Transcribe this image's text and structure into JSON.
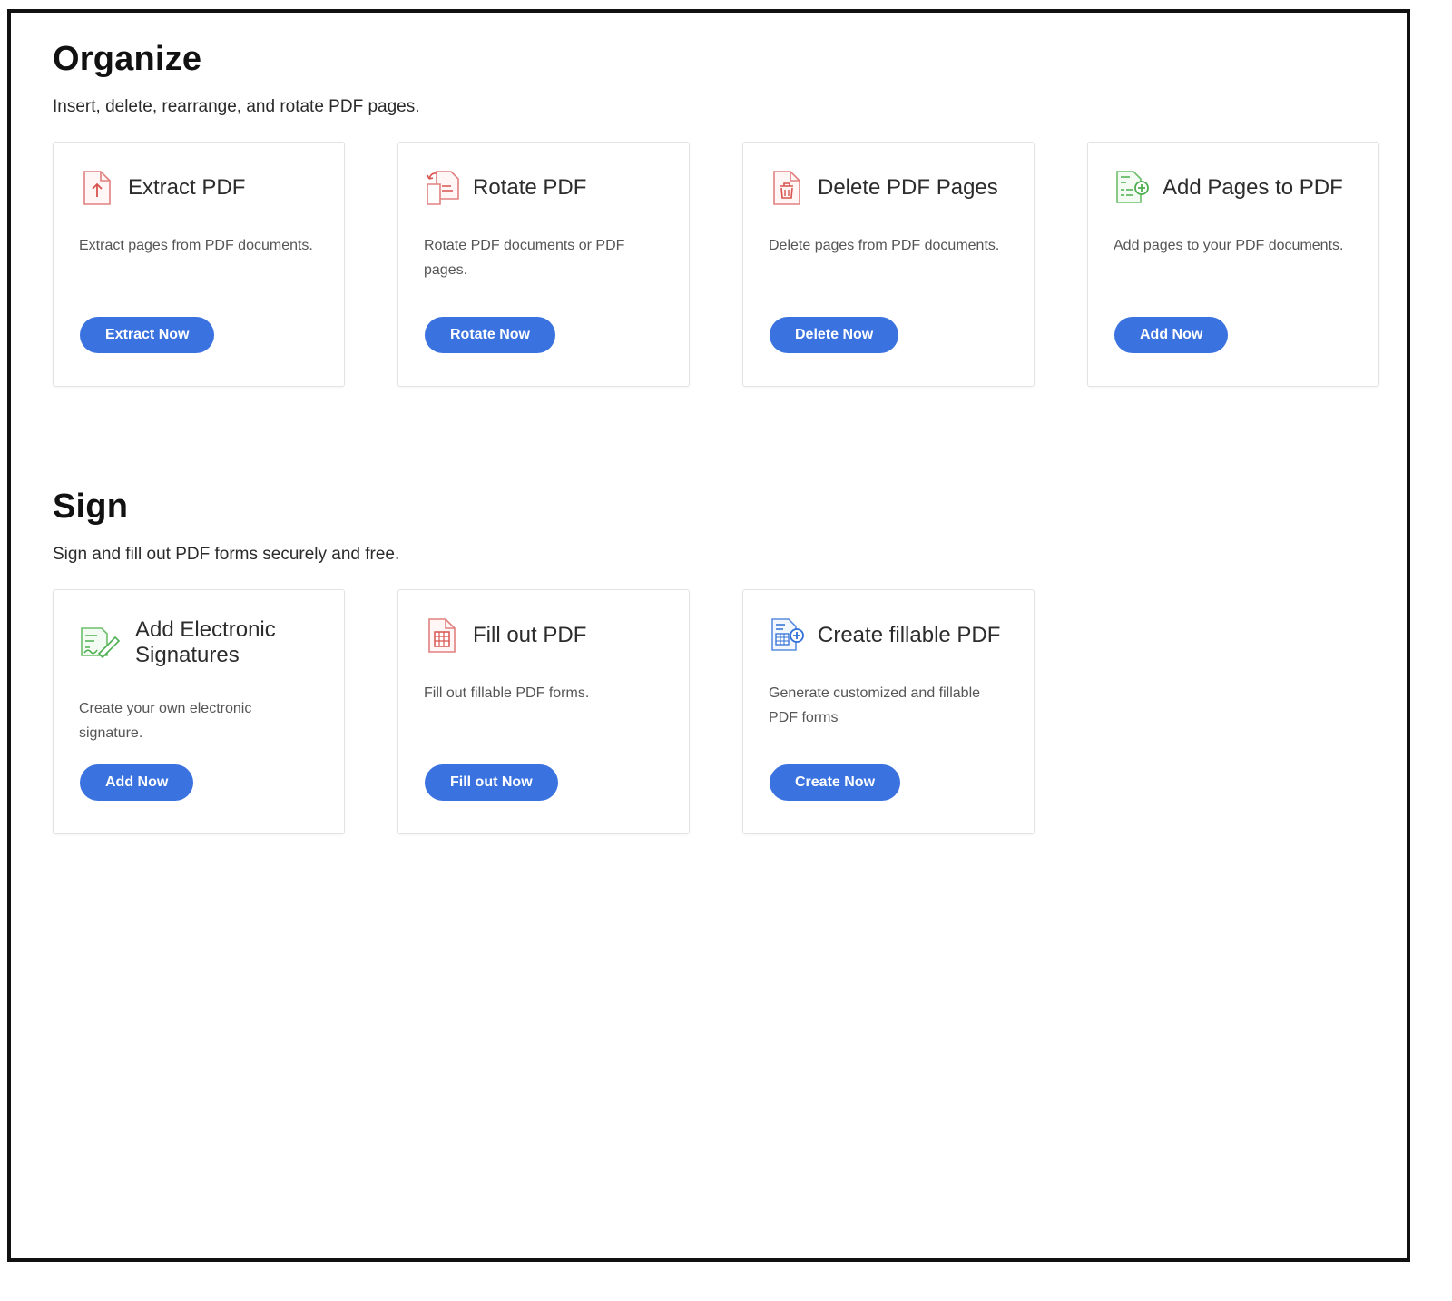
{
  "organize": {
    "title": "Organize",
    "description": "Insert, delete, rearrange, and rotate PDF pages.",
    "cards": [
      {
        "title": "Extract PDF",
        "description": "Extract pages from PDF documents.",
        "button": "Extract Now",
        "icon": "extract-pdf-icon"
      },
      {
        "title": "Rotate PDF",
        "description": "Rotate PDF documents or PDF pages.",
        "button": "Rotate Now",
        "icon": "rotate-pdf-icon"
      },
      {
        "title": "Delete PDF Pages",
        "description": "Delete pages from PDF documents.",
        "button": "Delete Now",
        "icon": "delete-pdf-icon"
      },
      {
        "title": "Add Pages to PDF",
        "description": "Add pages to your PDF documents.",
        "button": "Add Now",
        "icon": "add-pages-icon"
      }
    ]
  },
  "sign": {
    "title": "Sign",
    "description": "Sign and fill out PDF forms securely and free.",
    "cards": [
      {
        "title": "Add Electronic Signatures",
        "description": "Create your own electronic signature.",
        "button": "Add Now",
        "icon": "signature-icon"
      },
      {
        "title": "Fill out PDF",
        "description": "Fill out fillable PDF forms.",
        "button": "Fill out Now",
        "icon": "fill-form-icon"
      },
      {
        "title": "Create fillable PDF",
        "description": "Generate customized and fillable PDF forms",
        "button": "Create Now",
        "icon": "create-form-icon"
      }
    ]
  },
  "colors": {
    "button": "#3a72e0",
    "icon_red": "#d9534f",
    "icon_green": "#4caf50",
    "icon_blue": "#2f6fd6"
  }
}
